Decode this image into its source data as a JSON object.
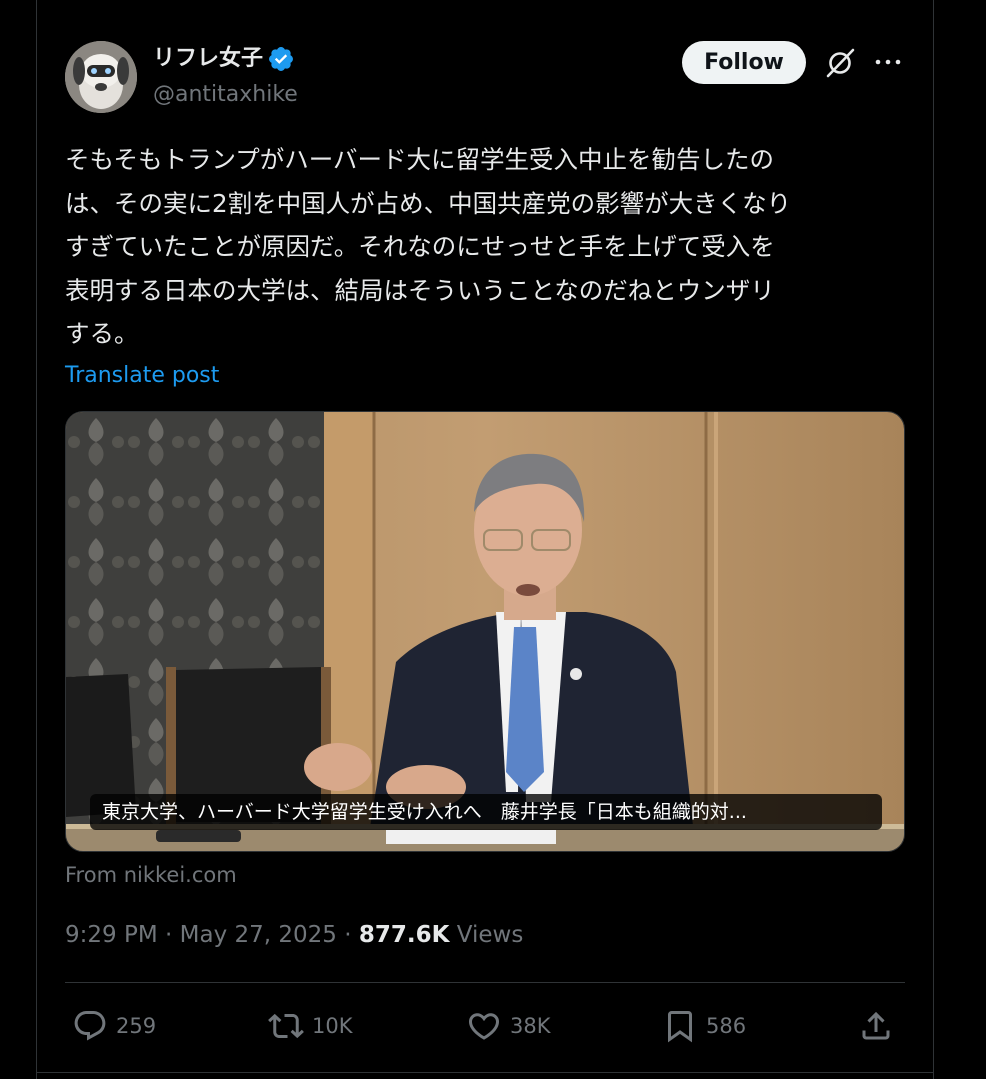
{
  "author": {
    "display_name": "リフレ女子",
    "handle": "@antitaxhike",
    "verified": true,
    "avatar_icon": "robot-dog-avatar"
  },
  "header": {
    "follow_label": "Follow",
    "grok_icon": "grok-icon",
    "more_icon": "more-dots-icon"
  },
  "post": {
    "text": "そもそもトランプがハーバード大に留学生受入中止を勧告したの\nは、その実に2割を中国人が占め、中国共産党の影響が大きくなり\nすぎていたことが原因だ。それなのにせっせと手を上げて受入を\n表明する日本の大学は、結局はそういうことなのだねとウンザリ\nする。",
    "translate_label": "Translate post"
  },
  "card": {
    "caption": "東京大学、ハーバード大学留学生受け入れへ　藤井学長「日本も組織的対...",
    "source": "From nikkei.com"
  },
  "meta": {
    "time": "9:29 PM",
    "separator": "·",
    "date": "May 27, 2025",
    "views_count": "877.6K",
    "views_label": "Views"
  },
  "actions": {
    "replies": "259",
    "reposts": "10K",
    "likes": "38K",
    "bookmarks": "586"
  },
  "colors": {
    "background": "#000000",
    "text": "#e7e9ea",
    "muted": "#71767b",
    "link": "#1d9bf0",
    "verified": "#1d9bf0",
    "divider": "#2f3336"
  }
}
